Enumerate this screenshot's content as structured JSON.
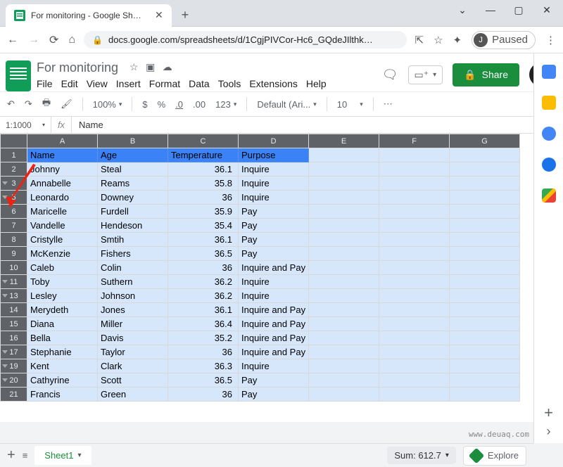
{
  "browser": {
    "tab_title": "For monitoring - Google Sheets",
    "url_display": "docs.google.com/spreadsheets/d/1CgjPIVCor-Hc6_GQdeJIlthk…",
    "profile_label": "Paused",
    "profile_initial": "J"
  },
  "doc": {
    "title": "For monitoring",
    "menus": [
      "File",
      "Edit",
      "View",
      "Insert",
      "Format",
      "Data",
      "Tools",
      "Extensions",
      "Help"
    ],
    "share": "Share"
  },
  "toolbar": {
    "zoom": "100%",
    "currency": "$",
    "percent": "%",
    "dec_dec": ".0",
    "dec_inc": ".00",
    "numfmt": "123",
    "font": "Default (Ari...",
    "fontsize": "10"
  },
  "namebox": "1:1000",
  "fx": "fx",
  "formula_value": "Name",
  "columns": [
    "A",
    "B",
    "C",
    "D",
    "E",
    "F",
    "G"
  ],
  "row1": {
    "A": "Name",
    "B": "Age",
    "C": "Temperature",
    "D": "Purpose"
  },
  "rows": [
    {
      "n": 2,
      "f": false,
      "A": "Johnny",
      "B": "Steal",
      "C": "36.1",
      "D": "Inquire"
    },
    {
      "n": 3,
      "f": true,
      "A": "Annabelle",
      "B": "Reams",
      "C": "35.8",
      "D": "Inquire"
    },
    {
      "n": 5,
      "f": true,
      "A": "Leonardo",
      "B": "Downey",
      "C": "36",
      "D": "Inquire"
    },
    {
      "n": 6,
      "f": false,
      "A": "Maricelle",
      "B": "Furdell",
      "C": "35.9",
      "D": "Pay"
    },
    {
      "n": 7,
      "f": false,
      "A": "Vandelle",
      "B": "Hendeson",
      "C": "35.4",
      "D": "Pay"
    },
    {
      "n": 8,
      "f": false,
      "A": "Cristylle",
      "B": "Smtih",
      "C": "36.1",
      "D": "Pay"
    },
    {
      "n": 9,
      "f": false,
      "A": "McKenzie",
      "B": "Fishers",
      "C": "36.5",
      "D": "Pay"
    },
    {
      "n": 10,
      "f": false,
      "A": "Caleb",
      "B": "Colin",
      "C": "36",
      "D": "Inquire and Pay"
    },
    {
      "n": 11,
      "f": true,
      "A": "Toby",
      "B": "Suthern",
      "C": "36.2",
      "D": "Inquire"
    },
    {
      "n": 13,
      "f": true,
      "A": "Lesley",
      "B": "Johnson",
      "C": "36.2",
      "D": "Inquire"
    },
    {
      "n": 14,
      "f": false,
      "A": "Merydeth",
      "B": "Jones",
      "C": "36.1",
      "D": "Inquire and Pay"
    },
    {
      "n": 15,
      "f": false,
      "A": "Diana",
      "B": "Miller",
      "C": "36.4",
      "D": "Inquire and Pay"
    },
    {
      "n": 16,
      "f": false,
      "A": "Bella",
      "B": "Davis",
      "C": "35.2",
      "D": "Inquire and Pay"
    },
    {
      "n": 17,
      "f": true,
      "A": "Stephanie",
      "B": "Taylor",
      "C": "36",
      "D": "Inquire and Pay"
    },
    {
      "n": 19,
      "f": true,
      "A": "Kent",
      "B": "Clark",
      "C": "36.3",
      "D": "Inquire"
    },
    {
      "n": 20,
      "f": true,
      "A": "Cathyrine",
      "B": "Scott",
      "C": "36.5",
      "D": "Pay"
    },
    {
      "n": 21,
      "f": false,
      "A": "Francis",
      "B": "Green",
      "C": "36",
      "D": "Pay"
    }
  ],
  "sheet_tab": "Sheet1",
  "sum": "Sum: 612.7",
  "explore": "Explore",
  "watermark": "www.deuaq.com"
}
